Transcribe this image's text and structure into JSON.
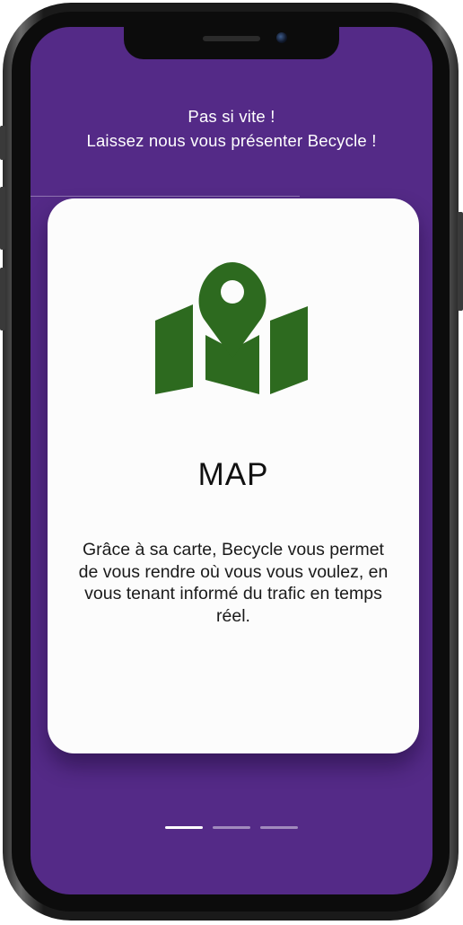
{
  "header": {
    "line1": "Pas si vite !",
    "line2": "Laissez nous vous présenter Becycle !"
  },
  "card": {
    "icon": "map-pin-icon",
    "title": "MAP",
    "description": "Grâce à sa carte, Becycle vous permet de vous rendre où vous vous voulez, en vous tenant informé du trafic en temps réel."
  },
  "pager": {
    "count": 3,
    "active_index": 0
  },
  "colors": {
    "background": "#542a87",
    "card": "#fcfcfc",
    "icon": "#2d6a1f",
    "text": "#111111",
    "header_text": "#ffffff"
  }
}
